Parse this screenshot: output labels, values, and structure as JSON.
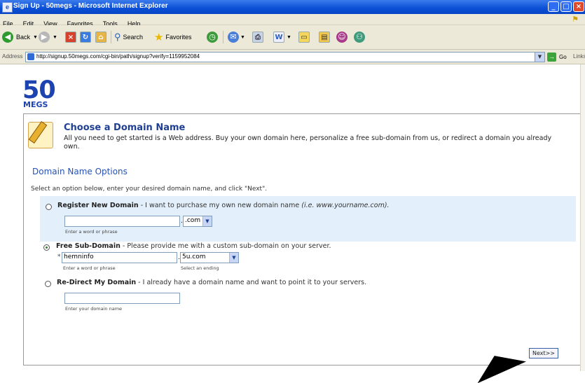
{
  "window": {
    "title": "Sign Up - 50megs - Microsoft Internet Explorer",
    "app_icon": "ie-page-icon"
  },
  "menu": [
    "File",
    "Edit",
    "View",
    "Favorites",
    "Tools",
    "Help"
  ],
  "toolbar": {
    "back_label": "Back",
    "search_label": "Search",
    "favorites_label": "Favorites"
  },
  "address": {
    "label": "Address",
    "url": "http://signup.50megs.com/cgi-bin/path/signup?verify=1159952084",
    "go_label": "Go",
    "links_label": "Links"
  },
  "logo": {
    "number": "50",
    "word": "MEGS",
    "color": "#1d43b0"
  },
  "section": {
    "title": "Choose a Domain Name",
    "intro": "All you need to get started is a Web address. Buy your own domain here, personalize a free sub-domain from us, or redirect a domain you already own.",
    "options_heading": "Domain Name Options",
    "instructions": "Select an option below, enter your desired domain name, and click \"Next\"."
  },
  "options": {
    "register": {
      "title": "Register New Domain",
      "desc": " - I want to purchase my own new domain name ",
      "example": "(i.e. www.yourname.com).",
      "input_value": "",
      "tld": ".com",
      "hint": "Enter a word or phrase",
      "selected": false
    },
    "subdomain": {
      "title": "Free Sub-Domain",
      "desc": " - Please provide me with a custom sub-domain on your server.",
      "required_mark": "*",
      "input_value": "hemninfo",
      "ending": "5u.com",
      "hint": "Enter a word or phrase",
      "ending_hint": "Select an ending",
      "selected": true
    },
    "redirect": {
      "title": "Re-Direct My Domain",
      "desc": " - I already have a domain name and want to point it to your servers.",
      "input_value": "",
      "hint": "Enter your domain name",
      "selected": false
    }
  },
  "next_button": "Next>>"
}
